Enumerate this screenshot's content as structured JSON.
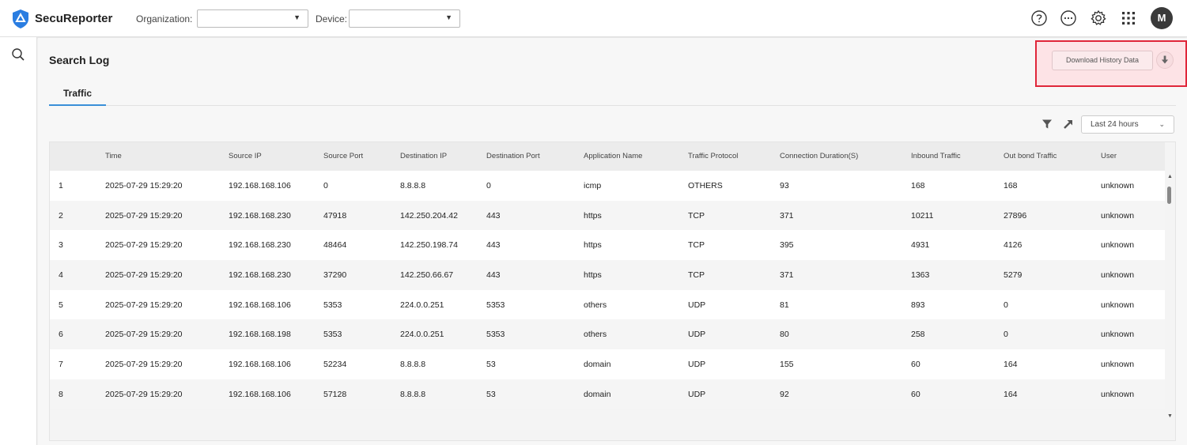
{
  "app": {
    "brand": "SecuReporter"
  },
  "header": {
    "organization_label": "Organization:",
    "organization_value": "",
    "device_label": "Device:",
    "device_value": "",
    "avatar_initial": "M"
  },
  "page": {
    "title": "Search Log"
  },
  "actions": {
    "download_history_label": "Download History Data"
  },
  "tabs": [
    {
      "label": "Traffic",
      "active": true
    }
  ],
  "toolbar": {
    "time_range": "Last 24 hours"
  },
  "colors": {
    "accent_tab": "#3a8fd8",
    "highlight": "#e0263a",
    "logo": "#2a7de1"
  },
  "table": {
    "columns": [
      "",
      "Time",
      "Source IP",
      "Source Port",
      "Destination IP",
      "Destination Port",
      "Application Name",
      "Traffic Protocol",
      "Connection Duration(S)",
      "Inbound Traffic",
      "Out bond Traffic",
      "User"
    ],
    "rows": [
      [
        "1",
        "2025-07-29 15:29:20",
        "192.168.168.106",
        "0",
        "8.8.8.8",
        "0",
        "icmp",
        "OTHERS",
        "93",
        "168",
        "168",
        "unknown"
      ],
      [
        "2",
        "2025-07-29 15:29:20",
        "192.168.168.230",
        "47918",
        "142.250.204.42",
        "443",
        "https",
        "TCP",
        "371",
        "10211",
        "27896",
        "unknown"
      ],
      [
        "3",
        "2025-07-29 15:29:20",
        "192.168.168.230",
        "48464",
        "142.250.198.74",
        "443",
        "https",
        "TCP",
        "395",
        "4931",
        "4126",
        "unknown"
      ],
      [
        "4",
        "2025-07-29 15:29:20",
        "192.168.168.230",
        "37290",
        "142.250.66.67",
        "443",
        "https",
        "TCP",
        "371",
        "1363",
        "5279",
        "unknown"
      ],
      [
        "5",
        "2025-07-29 15:29:20",
        "192.168.168.106",
        "5353",
        "224.0.0.251",
        "5353",
        "others",
        "UDP",
        "81",
        "893",
        "0",
        "unknown"
      ],
      [
        "6",
        "2025-07-29 15:29:20",
        "192.168.168.198",
        "5353",
        "224.0.0.251",
        "5353",
        "others",
        "UDP",
        "80",
        "258",
        "0",
        "unknown"
      ],
      [
        "7",
        "2025-07-29 15:29:20",
        "192.168.168.106",
        "52234",
        "8.8.8.8",
        "53",
        "domain",
        "UDP",
        "155",
        "60",
        "164",
        "unknown"
      ],
      [
        "8",
        "2025-07-29 15:29:20",
        "192.168.168.106",
        "57128",
        "8.8.8.8",
        "53",
        "domain",
        "UDP",
        "92",
        "60",
        "164",
        "unknown"
      ]
    ]
  },
  "icons": [
    "logo-shield-icon",
    "help-icon",
    "more-icon",
    "settings-icon",
    "apps-grid-icon",
    "search-icon",
    "download-icon",
    "filter-icon",
    "export-icon",
    "chevron-down-icon"
  ]
}
